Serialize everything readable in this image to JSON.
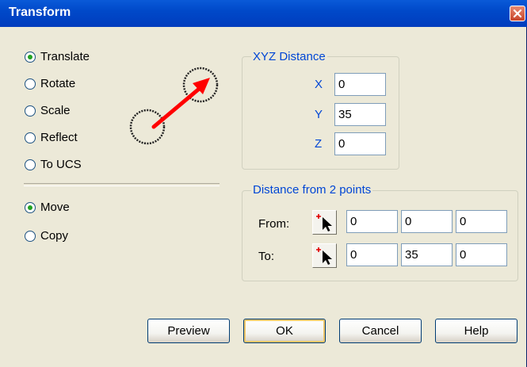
{
  "window": {
    "title": "Transform"
  },
  "operations": [
    {
      "label": "Translate",
      "checked": true
    },
    {
      "label": "Rotate",
      "checked": false
    },
    {
      "label": "Scale",
      "checked": false
    },
    {
      "label": "Reflect",
      "checked": false
    },
    {
      "label": "To UCS",
      "checked": false
    }
  ],
  "mode": [
    {
      "label": "Move",
      "checked": true
    },
    {
      "label": "Copy",
      "checked": false
    }
  ],
  "xyz": {
    "title": "XYZ Distance",
    "x_label": "X",
    "x_value": "0",
    "y_label": "Y",
    "y_value": "35",
    "z_label": "Z",
    "z_value": "0"
  },
  "two_points": {
    "title": "Distance from 2 points",
    "from_label": "From:",
    "to_label": "To:",
    "from": [
      "0",
      "0",
      "0"
    ],
    "to": [
      "0",
      "35",
      "0"
    ]
  },
  "buttons": {
    "preview": "Preview",
    "ok": "OK",
    "cancel": "Cancel",
    "help": "Help"
  },
  "icons": {
    "close": "close-icon",
    "illustration": "translate-arrow-icon",
    "pick": "pick-point-icon"
  },
  "colors": {
    "titlebar": "#0049c9",
    "group_title": "#0046d5",
    "radio_dot": "#21a121",
    "arrow": "#ff0000"
  }
}
